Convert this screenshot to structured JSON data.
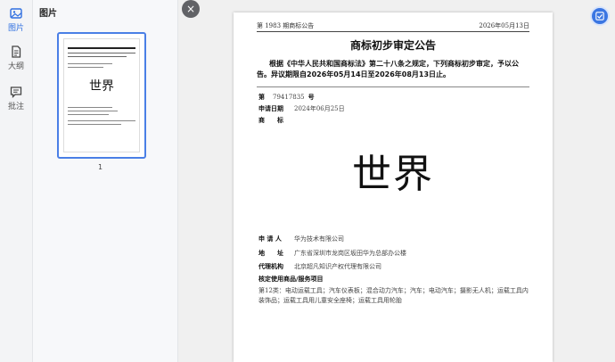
{
  "rail": {
    "items": [
      {
        "label": "图片",
        "icon": "image-icon"
      },
      {
        "label": "大纲",
        "icon": "document-outline-icon"
      },
      {
        "label": "批注",
        "icon": "comment-icon"
      }
    ]
  },
  "thumbs": {
    "title": "图片",
    "page_number": "1",
    "mark": "世界"
  },
  "close": {
    "symbol": "×"
  },
  "doc": {
    "header_left": "第 1983 期商标公告",
    "header_right": "2026年05月13日",
    "title": "商标初步审定公告",
    "intro": "根据《中华人民共和国商标法》第二十八条之规定，下列商标初步审定，予以公告。异议期限自2026年05月14日至2026年08月13日止。",
    "number_label": "第",
    "number_value": "79417835",
    "number_suffix": "号",
    "date_label": "申请日期",
    "date_value": "2024年06月25日",
    "mark_label": "商　　标",
    "mark": "世界",
    "applicant_label": "申 请 人",
    "applicant_value": "华为技术有限公司",
    "address_label": "地　　址",
    "address_value": "广东省深圳市龙岗区坂田华为总部办公楼",
    "agent_label": "代理机构",
    "agent_value": "北京超凡知识产权代理有限公司",
    "goods_label": "核定使用商品/服务项目",
    "goods_text": "第12类：电动运载工具；汽车仪表板；混合动力汽车；汽车；电动汽车；摄影无人机；运载工具内装饰品；运载工具用儿童安全座椅；运载工具用轮胎"
  },
  "colors": {
    "accent": "#2f6fe0",
    "fab": "#3b76e2"
  }
}
